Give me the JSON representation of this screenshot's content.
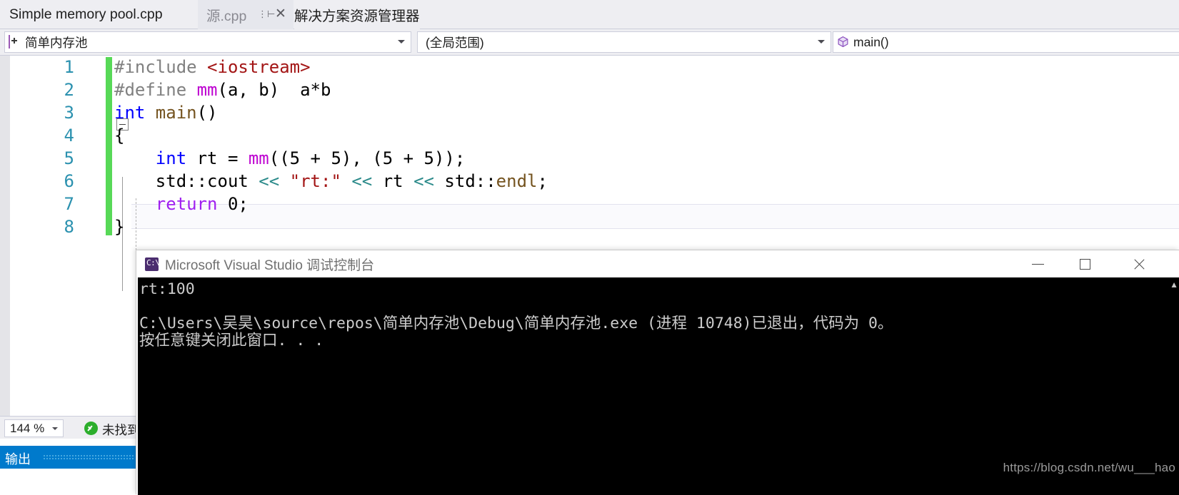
{
  "tabs": {
    "document_tab": "Simple memory pool.cpp",
    "source_tab": "源.cpp",
    "pin_icon": "pin-icon",
    "close_icon": "close-icon",
    "solution_explorer_tab": "解决方案资源管理器"
  },
  "navbar": {
    "project": {
      "value": "简单内存池",
      "icon": "project-icon"
    },
    "scope": {
      "value": "(全局范围)"
    },
    "symbol": {
      "value": "main()",
      "icon": "method-cube-icon"
    }
  },
  "editor": {
    "line_numbers": [
      "1",
      "2",
      "3",
      "4",
      "5",
      "6",
      "7",
      "8"
    ],
    "lines": [
      {
        "n": 1,
        "tokens": [
          {
            "t": "#include ",
            "c": "k-pre"
          },
          {
            "t": "<iostream>",
            "c": "k-str-ang"
          }
        ]
      },
      {
        "n": 2,
        "tokens": [
          {
            "t": "#define ",
            "c": "k-pre"
          },
          {
            "t": "mm",
            "c": "k-macro"
          },
          {
            "t": "(a, b)  a*b",
            "c": "k-plain"
          }
        ]
      },
      {
        "n": 3,
        "tokens": [
          {
            "t": "int ",
            "c": "k-kw"
          },
          {
            "t": "main",
            "c": "k-fn"
          },
          {
            "t": "()",
            "c": "k-plain"
          }
        ]
      },
      {
        "n": 4,
        "tokens": [
          {
            "t": "{",
            "c": "k-plain"
          }
        ]
      },
      {
        "n": 5,
        "tokens": [
          {
            "t": "    int ",
            "c": "k-kw"
          },
          {
            "t": "rt = ",
            "c": "k-plain"
          },
          {
            "t": "mm",
            "c": "k-macro"
          },
          {
            "t": "((5 + 5), (5 + 5));",
            "c": "k-plain"
          }
        ]
      },
      {
        "n": 6,
        "tokens": [
          {
            "t": "    std::cout ",
            "c": "k-plain"
          },
          {
            "t": "<< ",
            "c": "k-op"
          },
          {
            "t": "\"rt:\"",
            "c": "k-str"
          },
          {
            "t": " << ",
            "c": "k-op"
          },
          {
            "t": "rt ",
            "c": "k-plain"
          },
          {
            "t": "<< ",
            "c": "k-op"
          },
          {
            "t": "std::",
            "c": "k-plain"
          },
          {
            "t": "endl",
            "c": "k-fn"
          },
          {
            "t": ";",
            "c": "k-plain"
          }
        ]
      },
      {
        "n": 7,
        "tokens": [
          {
            "t": "    return ",
            "c": "k-kw2"
          },
          {
            "t": "0;",
            "c": "k-plain"
          }
        ]
      },
      {
        "n": 8,
        "tokens": [
          {
            "t": "}",
            "c": "k-plain"
          }
        ]
      }
    ],
    "collapse_icon": "collapse-minus-icon",
    "change_bar_color": "#57d957"
  },
  "console": {
    "title": "Microsoft Visual Studio 调试控制台",
    "app_icon": "console-cs-icon",
    "minimize_icon": "minimize-icon",
    "maximize_icon": "maximize-icon",
    "close_icon": "close-icon",
    "lines": [
      "rt:100",
      "",
      "C:\\Users\\吴昊\\source\\repos\\简单内存池\\Debug\\简单内存池.exe (进程 10748)已退出，代码为 0。",
      "按任意键关闭此窗口. . ."
    ],
    "background": "#000000",
    "foreground": "#cccccc"
  },
  "statusbar": {
    "zoom": "144 %",
    "zoom_arrow_icon": "chevron-down-icon",
    "check_icon": "check-circle-icon",
    "status_text": "未找到",
    "output_tab": "输出"
  },
  "watermark": "https://blog.csdn.net/wu___hao"
}
